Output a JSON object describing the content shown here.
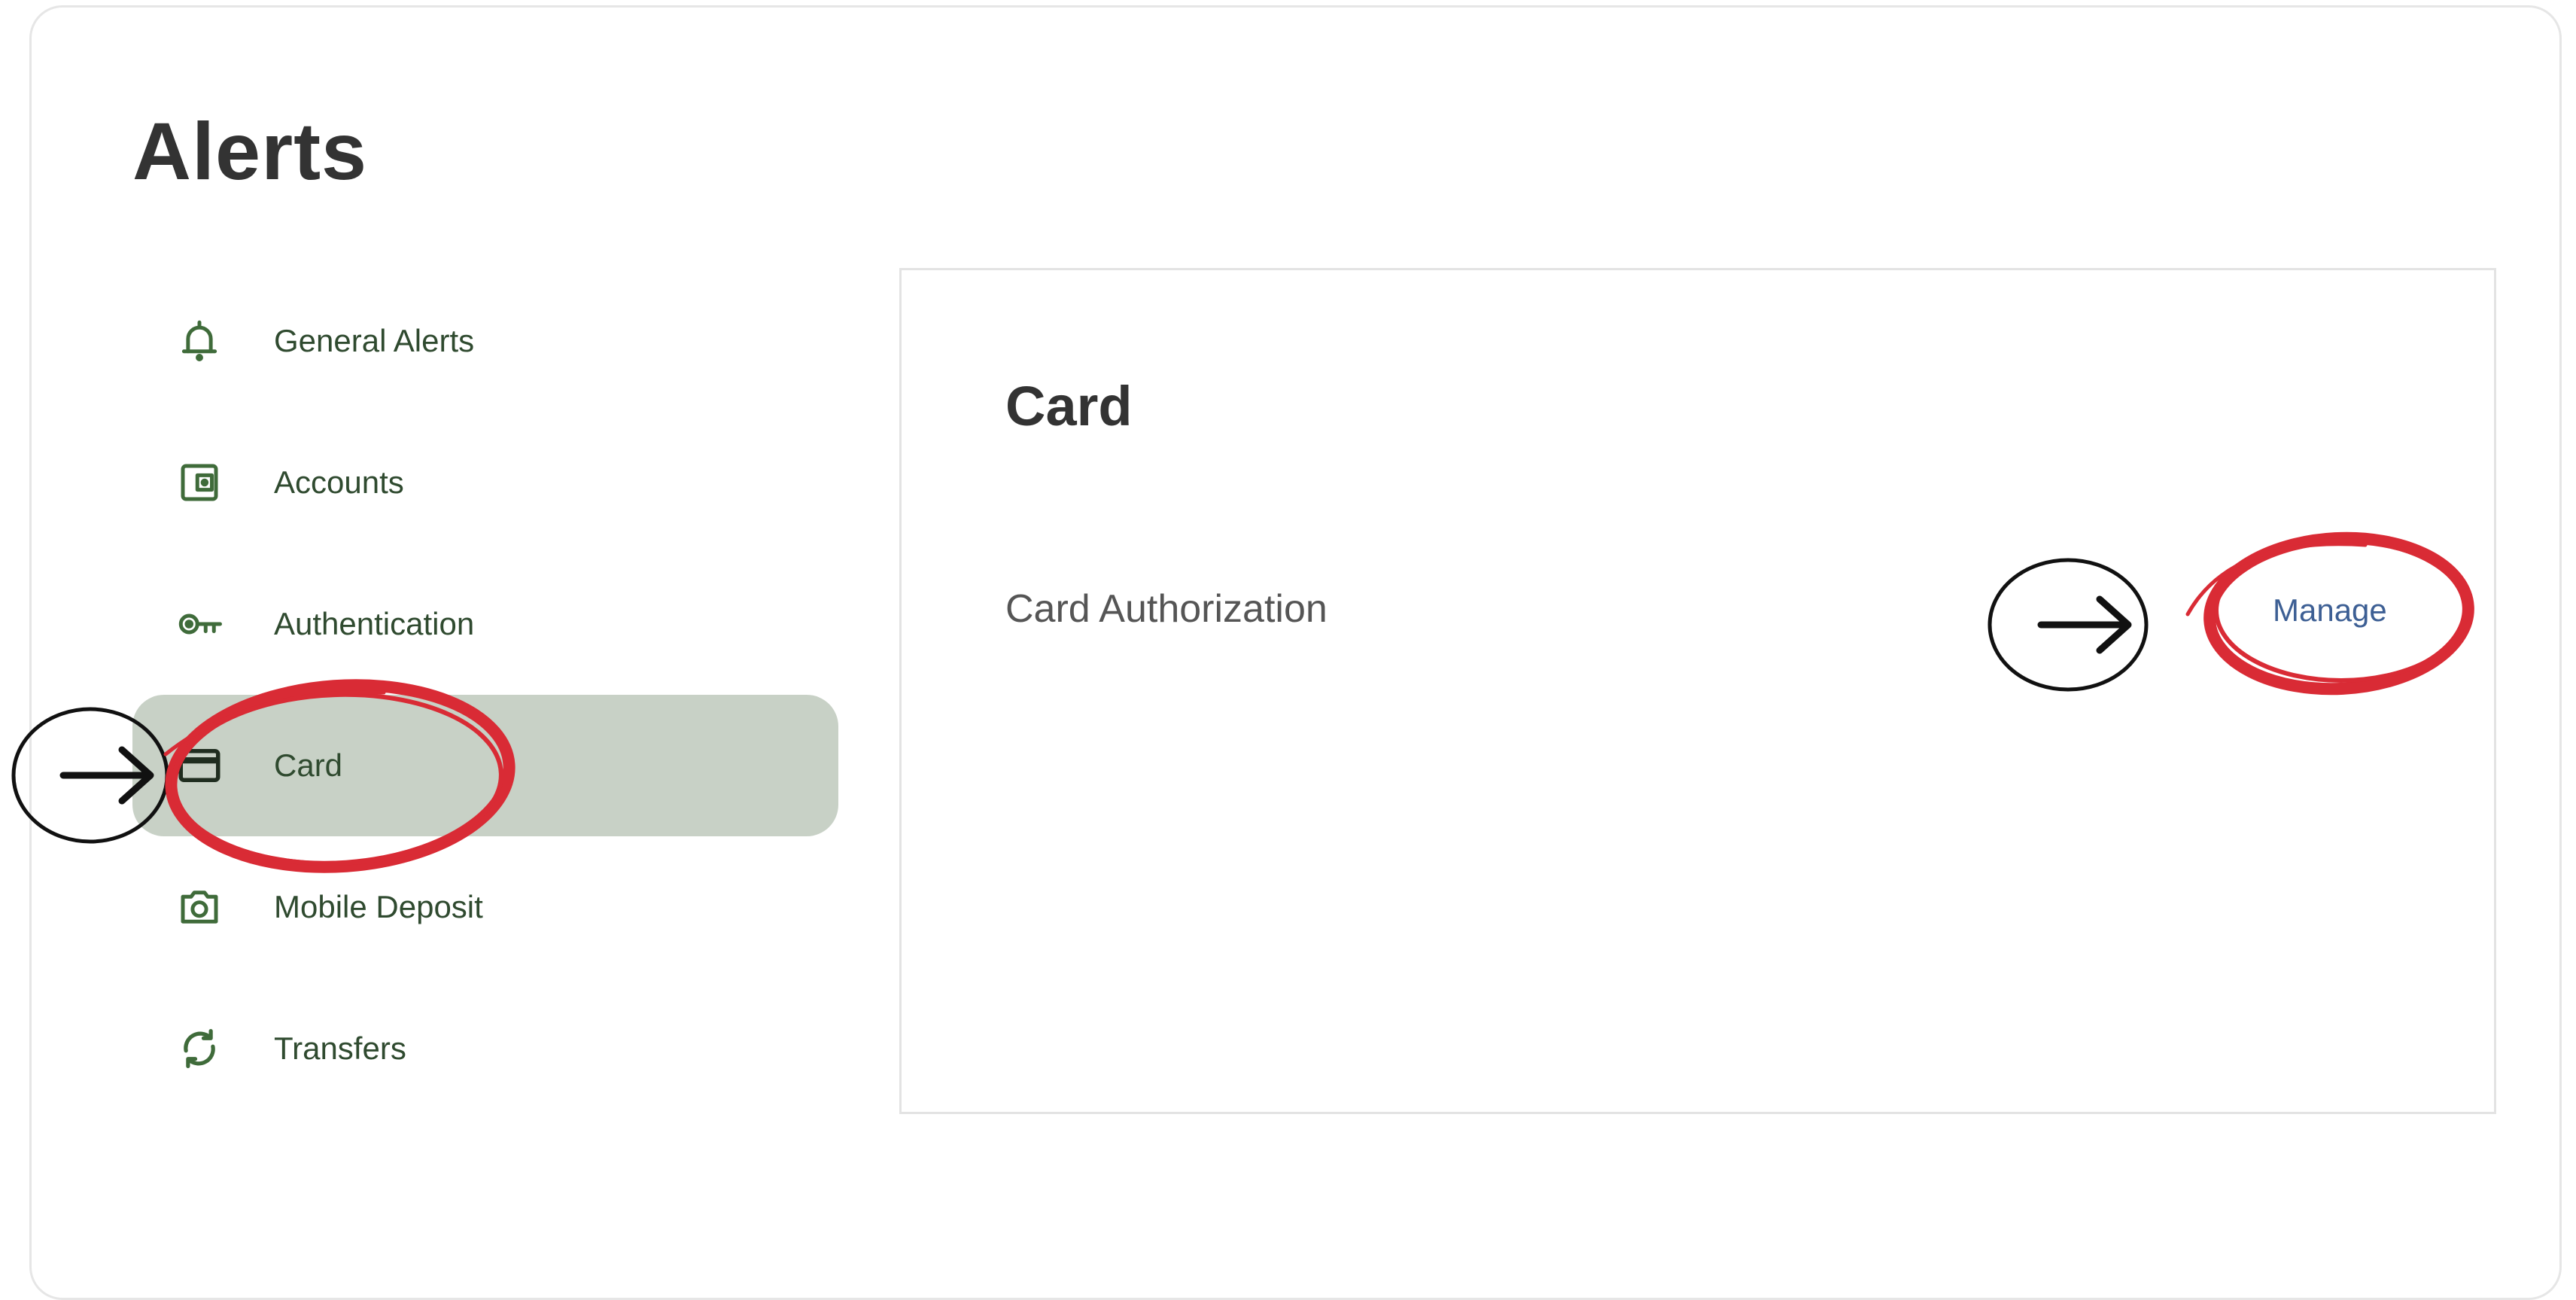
{
  "page": {
    "title": "Alerts"
  },
  "sidebar": {
    "items": [
      {
        "label": "General Alerts",
        "icon": "bell-icon",
        "active": false
      },
      {
        "label": "Accounts",
        "icon": "wallet-icon",
        "active": false
      },
      {
        "label": "Authentication",
        "icon": "key-icon",
        "active": false
      },
      {
        "label": "Card",
        "icon": "credit-card-icon",
        "active": true
      },
      {
        "label": "Mobile Deposit",
        "icon": "camera-icon",
        "active": false
      },
      {
        "label": "Transfers",
        "icon": "refresh-icon",
        "active": false
      }
    ]
  },
  "panel": {
    "title": "Card",
    "rows": [
      {
        "label": "Card Authorization",
        "action": "Manage"
      }
    ]
  },
  "colors": {
    "active_bg": "#c8d1c6",
    "nav_icon": "#3f6b3a",
    "nav_text": "#2f4a2f",
    "link": "#3d5f94",
    "annotation_red": "#d92b35",
    "annotation_black": "#111111"
  }
}
